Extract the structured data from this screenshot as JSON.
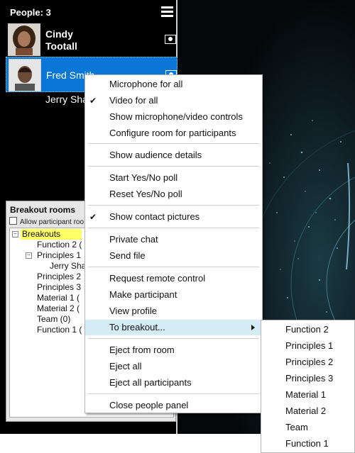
{
  "people_panel": {
    "header": "People: 3",
    "persons": [
      {
        "name_line1": "Cindy",
        "name_line2": "Tootall",
        "avatar": "woman-portrait"
      },
      {
        "name": "Fred Smith",
        "avatar": "man-portrait"
      },
      {
        "name": "Jerry Sha"
      }
    ]
  },
  "breakout": {
    "title": "Breakout rooms",
    "allow_label": "Allow participant roo",
    "tree": [
      {
        "label": "Breakouts"
      },
      {
        "label": "Function 2 ("
      },
      {
        "label": "Principles 1"
      },
      {
        "label": "Jerry Sha"
      },
      {
        "label": "Principles 2"
      },
      {
        "label": "Principles 3"
      },
      {
        "label": "Material 1 ("
      },
      {
        "label": "Material 2 ("
      },
      {
        "label": "Team (0)"
      },
      {
        "label": "Function 1 ("
      }
    ]
  },
  "context_menu": {
    "items": [
      {
        "label": "Microphone for all"
      },
      {
        "label": "Video for all",
        "checked": "✔"
      },
      {
        "label": "Show microphone/video controls"
      },
      {
        "label": "Configure room for participants"
      },
      {
        "label": "Show audience details"
      },
      {
        "label": "Start Yes/No poll"
      },
      {
        "label": "Reset Yes/No poll"
      },
      {
        "label": "Show contact pictures",
        "checked": "✔"
      },
      {
        "label": "Private chat"
      },
      {
        "label": "Send file"
      },
      {
        "label": "Request remote control"
      },
      {
        "label": "Make participant"
      },
      {
        "label": "View profile"
      },
      {
        "label": "To breakout..."
      },
      {
        "label": "Eject from room"
      },
      {
        "label": "Eject all"
      },
      {
        "label": "Eject all participants"
      },
      {
        "label": "Close people panel"
      }
    ]
  },
  "submenu": {
    "items": [
      "Function 2",
      "Principles 1",
      "Principles 2",
      "Principles 3",
      "Material 1",
      "Material 2",
      "Team",
      "Function 1"
    ]
  }
}
